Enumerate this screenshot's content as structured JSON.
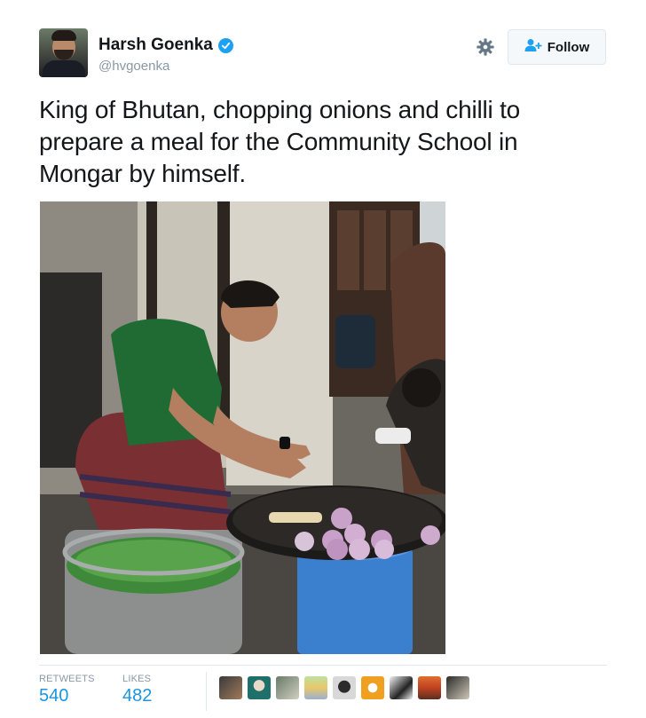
{
  "tweet": {
    "author": {
      "name": "Harsh Goenka",
      "handle": "@hvgoenka",
      "verified": true
    },
    "follow_label": "Follow",
    "text": "King of Bhutan, chopping onions and chilli to prepare a meal for the Community School in Mongar by himself.",
    "stats": {
      "retweets_label": "RETWEETS",
      "retweets": "540",
      "likes_label": "LIKES",
      "likes": "482"
    },
    "liker_avatars": 9
  },
  "icons": [
    "verified-icon",
    "gear-icon",
    "follow-user-icon"
  ],
  "colors": {
    "accent": "#1b95e0",
    "verified": "#1da1f2",
    "muted": "#8899a6",
    "border": "#e1e8ed"
  }
}
